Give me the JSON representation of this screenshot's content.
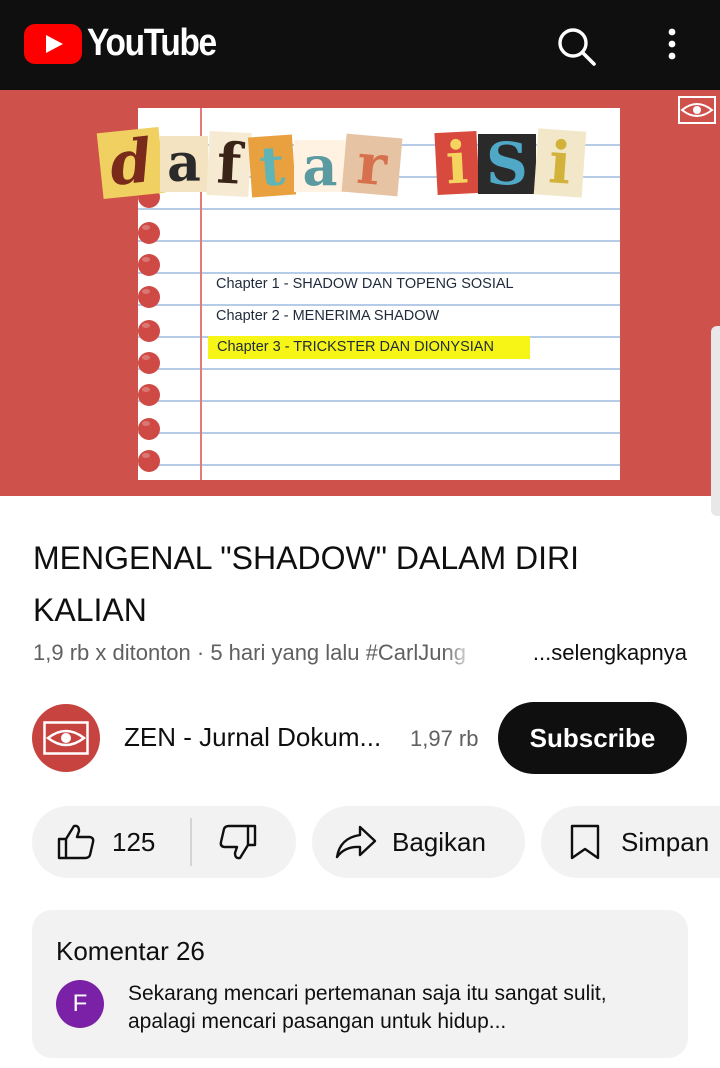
{
  "app": {
    "logo_text": "YouTube",
    "brand_color": "#ff0000",
    "topbar_icons": [
      "search-icon",
      "more-vert-icon"
    ]
  },
  "video": {
    "thumbnail": {
      "heading_letters": [
        "d",
        "a",
        "f",
        "t",
        "a",
        "r",
        "i",
        "S",
        "i"
      ],
      "chapters": [
        "Chapter 1 - SHADOW DAN TOPENG SOSIAL",
        "Chapter 2 - MENERIMA SHADOW",
        "Chapter 3 - TRICKSTER DAN DIONYSIAN"
      ],
      "highlighted_chapter_index": 2,
      "background_color": "#cf514c",
      "highlight_color": "#f7f516"
    },
    "title": "MENGENAL \"SHADOW\" DALAM DIRI KALIAN",
    "meta": {
      "views_and_date": "1,9 rb x ditonton · 5 hari yang lalu",
      "hashtag": "#CarlJung",
      "more_label": "...selengkapnya"
    }
  },
  "channel": {
    "name": "ZEN - Jurnal Dokum...",
    "subscribers": "1,97 rb",
    "subscribe_label": "Subscribe",
    "avatar_icon": "eye-logo-icon"
  },
  "actions": {
    "like_count": "125",
    "share_label": "Bagikan",
    "save_label": "Simpan"
  },
  "comments": {
    "title": "Komentar 26",
    "top_comment": {
      "avatar_letter": "F",
      "avatar_color": "#7b21a8",
      "text": "Sekarang mencari pertemanan saja itu sangat sulit, apalagi mencari pasangan untuk hidup..."
    }
  }
}
